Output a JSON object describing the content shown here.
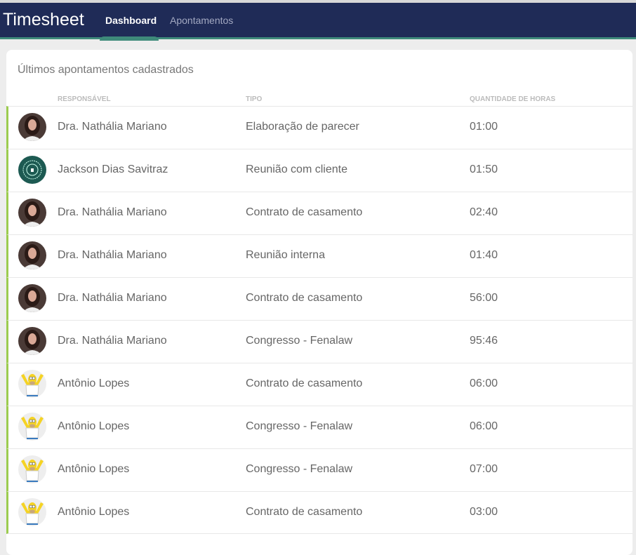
{
  "app": {
    "title": "Timesheet",
    "tabs": [
      {
        "label": "Dashboard",
        "active": true
      },
      {
        "label": "Apontamentos",
        "active": false
      }
    ]
  },
  "card": {
    "title": "Últimos apontamentos cadastrados",
    "columns": [
      "RESPONSÁVEL",
      "TIPO",
      "QUANTIDADE DE HORAS"
    ],
    "rows": [
      {
        "avatar": "woman",
        "name": "Dra. Nathália Mariano",
        "tipo": "Elaboração de parecer",
        "horas": "01:00"
      },
      {
        "avatar": "logo",
        "name": "Jackson Dias Savitraz",
        "tipo": "Reunião com cliente",
        "horas": "01:50"
      },
      {
        "avatar": "woman",
        "name": "Dra. Nathália Mariano",
        "tipo": "Contrato de casamento",
        "horas": "02:40"
      },
      {
        "avatar": "woman",
        "name": "Dra. Nathália Mariano",
        "tipo": "Reunião interna",
        "horas": "01:40"
      },
      {
        "avatar": "woman",
        "name": "Dra. Nathália Mariano",
        "tipo": "Contrato de casamento",
        "horas": "56:00"
      },
      {
        "avatar": "woman",
        "name": "Dra. Nathália Mariano",
        "tipo": "Congresso - Fenalaw",
        "horas": "95:46"
      },
      {
        "avatar": "cartoon",
        "name": "Antônio Lopes",
        "tipo": "Contrato de casamento",
        "horas": "06:00"
      },
      {
        "avatar": "cartoon",
        "name": "Antônio Lopes",
        "tipo": "Congresso - Fenalaw",
        "horas": "06:00"
      },
      {
        "avatar": "cartoon",
        "name": "Antônio Lopes",
        "tipo": "Congresso - Fenalaw",
        "horas": "07:00"
      },
      {
        "avatar": "cartoon",
        "name": "Antônio Lopes",
        "tipo": "Contrato de casamento",
        "horas": "03:00"
      }
    ]
  }
}
